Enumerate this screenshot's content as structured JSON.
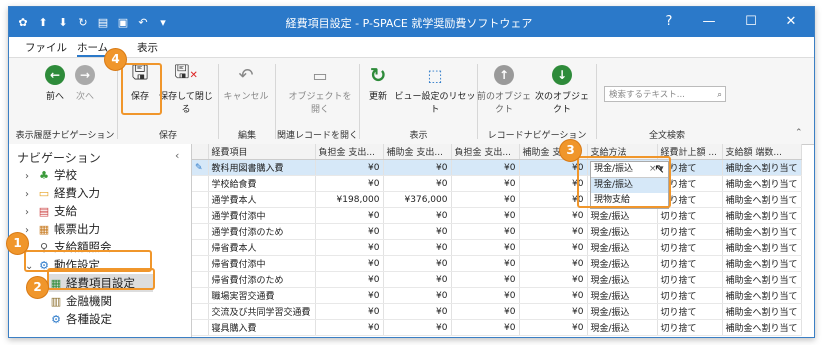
{
  "window": {
    "title": "経費項目設定 - P-SPACE 就学奨励費ソフトウェア"
  },
  "menu": {
    "file": "ファイル",
    "home": "ホーム",
    "view": "表示"
  },
  "ribbon": {
    "buttons": {
      "prev": "前へ",
      "next": "次へ",
      "save": "保存",
      "save_close": "保存して閉じる",
      "cancel": "キャンセル",
      "open_object": "オブジェクトを開く",
      "refresh": "更新",
      "reset_view": "ビュー設定のリセット",
      "prev_object": "前のオブジェクト",
      "next_object": "次のオブジェクト"
    },
    "groups": {
      "history": "表示履歴ナビゲーション",
      "save": "保存",
      "edit": "編集",
      "related": "関連レコードを開く",
      "view": "表示",
      "record_nav": "レコードナビゲーション",
      "search": "全文検索"
    },
    "search_placeholder": "検索するテキスト..."
  },
  "nav": {
    "header": "ナビゲーション",
    "items": [
      {
        "label": "学校"
      },
      {
        "label": "経費入力"
      },
      {
        "label": "支給"
      },
      {
        "label": "帳票出力"
      },
      {
        "label": "支給額照会"
      },
      {
        "label": "動作設定"
      },
      {
        "label": "経費項目設定"
      },
      {
        "label": "金融機関"
      },
      {
        "label": "各種設定"
      }
    ]
  },
  "grid": {
    "columns": [
      "経費項目",
      "負担金 支出...",
      "補助金 支出...",
      "負担金 支出...",
      "補助金 支出...",
      "支給方法",
      "経費計上額 ...",
      "支給額 端数..."
    ],
    "rows": [
      [
        "教科用図書購入費",
        "¥0",
        "¥0",
        "¥0",
        "¥0",
        "現金/振込",
        "切り捨て",
        "補助金へ割り当て"
      ],
      [
        "学校給食費",
        "¥0",
        "¥0",
        "¥0",
        "¥0",
        "現金/振込",
        "切り捨て",
        "補助金へ割り当て"
      ],
      [
        "通学費本人",
        "¥198,000",
        "¥376,000",
        "¥0",
        "¥0",
        "現金/振込",
        "切り捨て",
        "補助金へ割り当て"
      ],
      [
        "通学費付添中",
        "¥0",
        "¥0",
        "¥0",
        "¥0",
        "現金/振込",
        "切り捨て",
        "補助金へ割り当て"
      ],
      [
        "通学費付添のため",
        "¥0",
        "¥0",
        "¥0",
        "¥0",
        "現金/振込",
        "切り捨て",
        "補助金へ割り当て"
      ],
      [
        "帰省費本人",
        "¥0",
        "¥0",
        "¥0",
        "¥0",
        "現金/振込",
        "切り捨て",
        "補助金へ割り当て"
      ],
      [
        "帰省費付添中",
        "¥0",
        "¥0",
        "¥0",
        "¥0",
        "現金/振込",
        "切り捨て",
        "補助金へ割り当て"
      ],
      [
        "帰省費付添のため",
        "¥0",
        "¥0",
        "¥0",
        "¥0",
        "現金/振込",
        "切り捨て",
        "補助金へ割り当て"
      ],
      [
        "職場実習交通費",
        "¥0",
        "¥0",
        "¥0",
        "¥0",
        "現金/振込",
        "切り捨て",
        "補助金へ割り当て"
      ],
      [
        "交流及び共同学習交通費",
        "¥0",
        "¥0",
        "¥0",
        "¥0",
        "現金/振込",
        "切り捨て",
        "補助金へ割り当て"
      ],
      [
        "寝具購入費",
        "¥0",
        "¥0",
        "¥0",
        "¥0",
        "現金/振込",
        "切り捨て",
        "補助金へ割り当て"
      ]
    ],
    "dropdown": {
      "value": "現金/振込",
      "options": [
        "現金/振込",
        "現物支給"
      ]
    }
  },
  "callouts": [
    "1",
    "2",
    "3",
    "4"
  ]
}
